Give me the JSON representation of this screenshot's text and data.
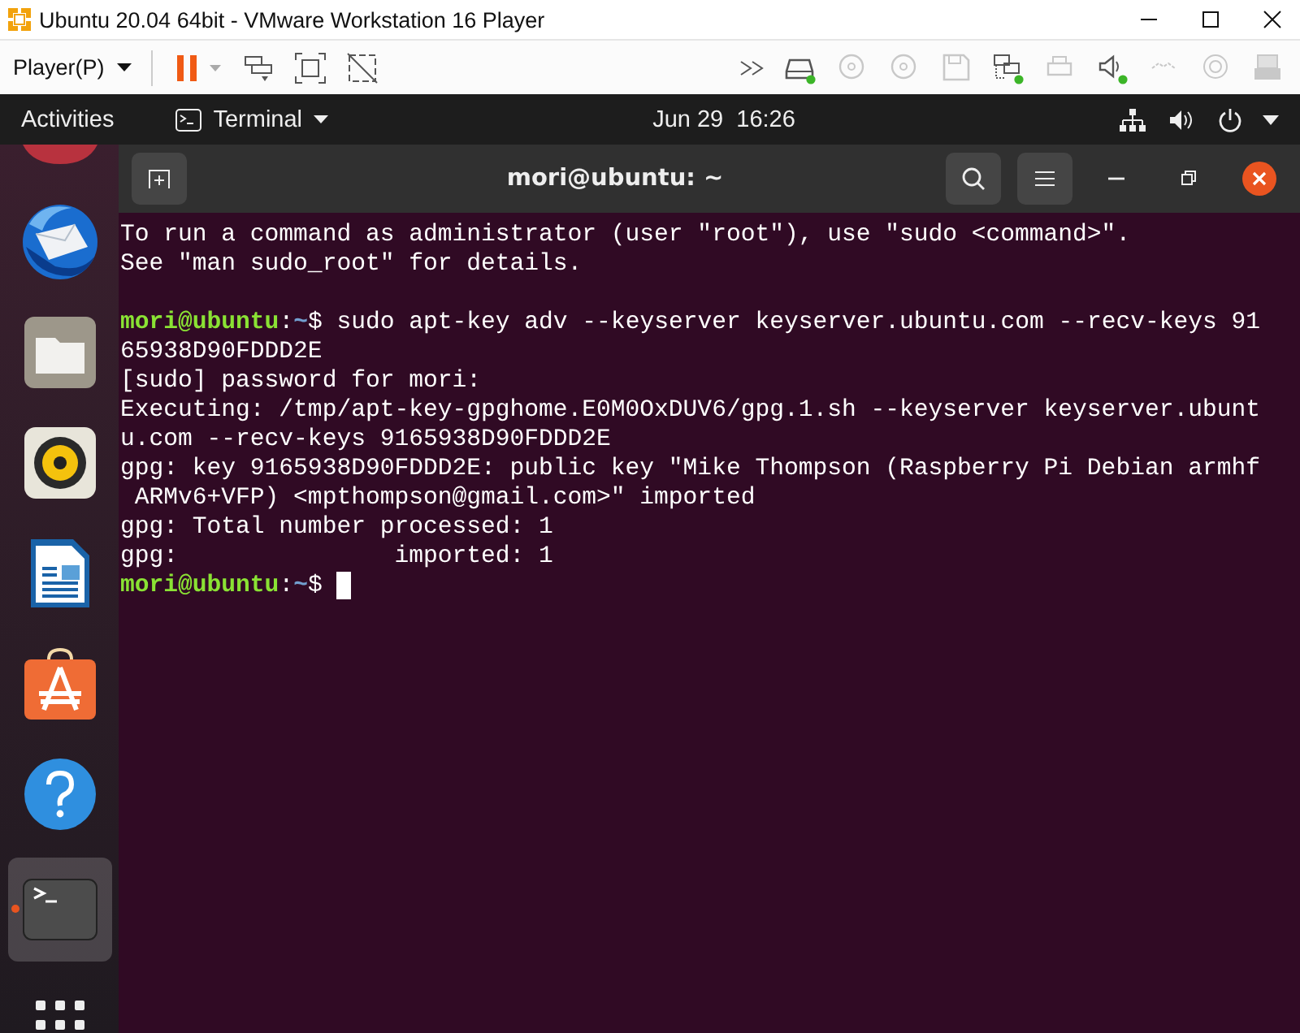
{
  "window": {
    "title": "Ubuntu 20.04 64bit - VMware Workstation 16 Player"
  },
  "toolbar": {
    "player_menu": "Player(P)",
    "devices": [
      {
        "kind": "disk",
        "connected": true,
        "disabled": false
      },
      {
        "kind": "cd",
        "connected": false,
        "disabled": true
      },
      {
        "kind": "cd",
        "connected": false,
        "disabled": true
      },
      {
        "kind": "floppy",
        "connected": false,
        "disabled": true
      },
      {
        "kind": "network",
        "connected": true,
        "disabled": false
      },
      {
        "kind": "printer",
        "connected": false,
        "disabled": true
      },
      {
        "kind": "sound",
        "connected": true,
        "disabled": false
      },
      {
        "kind": "camera",
        "connected": false,
        "disabled": true
      },
      {
        "kind": "disc",
        "connected": false,
        "disabled": true
      },
      {
        "kind": "usb",
        "connected": false,
        "disabled": true
      }
    ]
  },
  "top_bar": {
    "activities": "Activities",
    "app_menu": "Terminal",
    "date": "Jun 29",
    "time": "16:26"
  },
  "dock": {
    "items": [
      {
        "kind": "partial",
        "selected": false,
        "running": false
      },
      {
        "kind": "mail",
        "selected": false,
        "running": false
      },
      {
        "kind": "files",
        "selected": false,
        "running": false
      },
      {
        "kind": "music",
        "selected": false,
        "running": false
      },
      {
        "kind": "writer",
        "selected": false,
        "running": false
      },
      {
        "kind": "software",
        "selected": false,
        "running": false
      },
      {
        "kind": "help",
        "selected": false,
        "running": false
      },
      {
        "kind": "terminal",
        "selected": true,
        "running": true
      },
      {
        "kind": "apps",
        "selected": false,
        "running": false
      }
    ]
  },
  "terminal": {
    "title": "mori@ubuntu: ~",
    "lines": [
      [
        {
          "kind": "plain",
          "text": "To run a command as administrator (user \"root\"), use \"sudo <command>\"."
        }
      ],
      [
        {
          "kind": "plain",
          "text": "See \"man sudo_root\" for details."
        }
      ],
      [
        {
          "kind": "blank"
        }
      ],
      [
        {
          "kind": "user",
          "text": "mori@ubuntu"
        },
        {
          "kind": "plain",
          "text": ":"
        },
        {
          "kind": "path",
          "text": "~"
        },
        {
          "kind": "plain",
          "text": "$ sudo apt-key adv --keyserver keyserver.ubuntu.com --recv-keys 91"
        }
      ],
      [
        {
          "kind": "plain",
          "text": "65938D90FDDD2E"
        }
      ],
      [
        {
          "kind": "plain",
          "text": "[sudo] password for mori:"
        }
      ],
      [
        {
          "kind": "plain",
          "text": "Executing: /tmp/apt-key-gpghome.E0M0OxDUV6/gpg.1.sh --keyserver keyserver.ubunt"
        }
      ],
      [
        {
          "kind": "plain",
          "text": "u.com --recv-keys 9165938D90FDDD2E"
        }
      ],
      [
        {
          "kind": "plain",
          "text": "gpg: key 9165938D90FDDD2E: public key \"Mike Thompson (Raspberry Pi Debian armhf"
        }
      ],
      [
        {
          "kind": "plain",
          "text": " ARMv6+VFP) <mpthompson@gmail.com>\" imported"
        }
      ],
      [
        {
          "kind": "plain",
          "text": "gpg: Total number processed: 1"
        }
      ],
      [
        {
          "kind": "plain",
          "text": "gpg:               imported: 1"
        }
      ],
      [
        {
          "kind": "user",
          "text": "mori@ubuntu"
        },
        {
          "kind": "plain",
          "text": ":"
        },
        {
          "kind": "path",
          "text": "~"
        },
        {
          "kind": "plain",
          "text": "$ "
        },
        {
          "kind": "cursor"
        }
      ]
    ]
  }
}
